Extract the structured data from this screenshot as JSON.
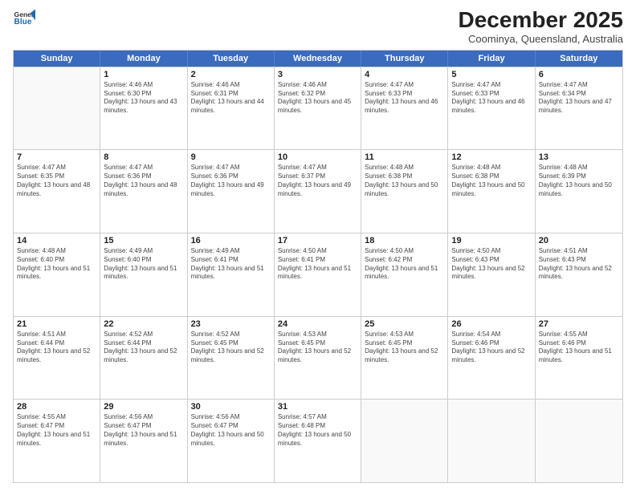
{
  "header": {
    "logo": {
      "general": "General",
      "blue": "Blue"
    },
    "title": "December 2025",
    "location": "Coominya, Queensland, Australia"
  },
  "weekdays": [
    "Sunday",
    "Monday",
    "Tuesday",
    "Wednesday",
    "Thursday",
    "Friday",
    "Saturday"
  ],
  "weeks": [
    [
      {
        "day": "",
        "sunrise": "",
        "sunset": "",
        "daylight": "",
        "empty": true
      },
      {
        "day": "1",
        "sunrise": "Sunrise: 4:46 AM",
        "sunset": "Sunset: 6:30 PM",
        "daylight": "Daylight: 13 hours and 43 minutes.",
        "empty": false
      },
      {
        "day": "2",
        "sunrise": "Sunrise: 4:46 AM",
        "sunset": "Sunset: 6:31 PM",
        "daylight": "Daylight: 13 hours and 44 minutes.",
        "empty": false
      },
      {
        "day": "3",
        "sunrise": "Sunrise: 4:46 AM",
        "sunset": "Sunset: 6:32 PM",
        "daylight": "Daylight: 13 hours and 45 minutes.",
        "empty": false
      },
      {
        "day": "4",
        "sunrise": "Sunrise: 4:47 AM",
        "sunset": "Sunset: 6:33 PM",
        "daylight": "Daylight: 13 hours and 46 minutes.",
        "empty": false
      },
      {
        "day": "5",
        "sunrise": "Sunrise: 4:47 AM",
        "sunset": "Sunset: 6:33 PM",
        "daylight": "Daylight: 13 hours and 46 minutes.",
        "empty": false
      },
      {
        "day": "6",
        "sunrise": "Sunrise: 4:47 AM",
        "sunset": "Sunset: 6:34 PM",
        "daylight": "Daylight: 13 hours and 47 minutes.",
        "empty": false
      }
    ],
    [
      {
        "day": "7",
        "sunrise": "Sunrise: 4:47 AM",
        "sunset": "Sunset: 6:35 PM",
        "daylight": "Daylight: 13 hours and 48 minutes.",
        "empty": false
      },
      {
        "day": "8",
        "sunrise": "Sunrise: 4:47 AM",
        "sunset": "Sunset: 6:36 PM",
        "daylight": "Daylight: 13 hours and 48 minutes.",
        "empty": false
      },
      {
        "day": "9",
        "sunrise": "Sunrise: 4:47 AM",
        "sunset": "Sunset: 6:36 PM",
        "daylight": "Daylight: 13 hours and 49 minutes.",
        "empty": false
      },
      {
        "day": "10",
        "sunrise": "Sunrise: 4:47 AM",
        "sunset": "Sunset: 6:37 PM",
        "daylight": "Daylight: 13 hours and 49 minutes.",
        "empty": false
      },
      {
        "day": "11",
        "sunrise": "Sunrise: 4:48 AM",
        "sunset": "Sunset: 6:38 PM",
        "daylight": "Daylight: 13 hours and 50 minutes.",
        "empty": false
      },
      {
        "day": "12",
        "sunrise": "Sunrise: 4:48 AM",
        "sunset": "Sunset: 6:38 PM",
        "daylight": "Daylight: 13 hours and 50 minutes.",
        "empty": false
      },
      {
        "day": "13",
        "sunrise": "Sunrise: 4:48 AM",
        "sunset": "Sunset: 6:39 PM",
        "daylight": "Daylight: 13 hours and 50 minutes.",
        "empty": false
      }
    ],
    [
      {
        "day": "14",
        "sunrise": "Sunrise: 4:48 AM",
        "sunset": "Sunset: 6:40 PM",
        "daylight": "Daylight: 13 hours and 51 minutes.",
        "empty": false
      },
      {
        "day": "15",
        "sunrise": "Sunrise: 4:49 AM",
        "sunset": "Sunset: 6:40 PM",
        "daylight": "Daylight: 13 hours and 51 minutes.",
        "empty": false
      },
      {
        "day": "16",
        "sunrise": "Sunrise: 4:49 AM",
        "sunset": "Sunset: 6:41 PM",
        "daylight": "Daylight: 13 hours and 51 minutes.",
        "empty": false
      },
      {
        "day": "17",
        "sunrise": "Sunrise: 4:50 AM",
        "sunset": "Sunset: 6:41 PM",
        "daylight": "Daylight: 13 hours and 51 minutes.",
        "empty": false
      },
      {
        "day": "18",
        "sunrise": "Sunrise: 4:50 AM",
        "sunset": "Sunset: 6:42 PM",
        "daylight": "Daylight: 13 hours and 51 minutes.",
        "empty": false
      },
      {
        "day": "19",
        "sunrise": "Sunrise: 4:50 AM",
        "sunset": "Sunset: 6:43 PM",
        "daylight": "Daylight: 13 hours and 52 minutes.",
        "empty": false
      },
      {
        "day": "20",
        "sunrise": "Sunrise: 4:51 AM",
        "sunset": "Sunset: 6:43 PM",
        "daylight": "Daylight: 13 hours and 52 minutes.",
        "empty": false
      }
    ],
    [
      {
        "day": "21",
        "sunrise": "Sunrise: 4:51 AM",
        "sunset": "Sunset: 6:44 PM",
        "daylight": "Daylight: 13 hours and 52 minutes.",
        "empty": false
      },
      {
        "day": "22",
        "sunrise": "Sunrise: 4:52 AM",
        "sunset": "Sunset: 6:44 PM",
        "daylight": "Daylight: 13 hours and 52 minutes.",
        "empty": false
      },
      {
        "day": "23",
        "sunrise": "Sunrise: 4:52 AM",
        "sunset": "Sunset: 6:45 PM",
        "daylight": "Daylight: 13 hours and 52 minutes.",
        "empty": false
      },
      {
        "day": "24",
        "sunrise": "Sunrise: 4:53 AM",
        "sunset": "Sunset: 6:45 PM",
        "daylight": "Daylight: 13 hours and 52 minutes.",
        "empty": false
      },
      {
        "day": "25",
        "sunrise": "Sunrise: 4:53 AM",
        "sunset": "Sunset: 6:45 PM",
        "daylight": "Daylight: 13 hours and 52 minutes.",
        "empty": false
      },
      {
        "day": "26",
        "sunrise": "Sunrise: 4:54 AM",
        "sunset": "Sunset: 6:46 PM",
        "daylight": "Daylight: 13 hours and 52 minutes.",
        "empty": false
      },
      {
        "day": "27",
        "sunrise": "Sunrise: 4:55 AM",
        "sunset": "Sunset: 6:46 PM",
        "daylight": "Daylight: 13 hours and 51 minutes.",
        "empty": false
      }
    ],
    [
      {
        "day": "28",
        "sunrise": "Sunrise: 4:55 AM",
        "sunset": "Sunset: 6:47 PM",
        "daylight": "Daylight: 13 hours and 51 minutes.",
        "empty": false
      },
      {
        "day": "29",
        "sunrise": "Sunrise: 4:56 AM",
        "sunset": "Sunset: 6:47 PM",
        "daylight": "Daylight: 13 hours and 51 minutes.",
        "empty": false
      },
      {
        "day": "30",
        "sunrise": "Sunrise: 4:56 AM",
        "sunset": "Sunset: 6:47 PM",
        "daylight": "Daylight: 13 hours and 50 minutes.",
        "empty": false
      },
      {
        "day": "31",
        "sunrise": "Sunrise: 4:57 AM",
        "sunset": "Sunset: 6:48 PM",
        "daylight": "Daylight: 13 hours and 50 minutes.",
        "empty": false
      },
      {
        "day": "",
        "sunrise": "",
        "sunset": "",
        "daylight": "",
        "empty": true
      },
      {
        "day": "",
        "sunrise": "",
        "sunset": "",
        "daylight": "",
        "empty": true
      },
      {
        "day": "",
        "sunrise": "",
        "sunset": "",
        "daylight": "",
        "empty": true
      }
    ]
  ]
}
